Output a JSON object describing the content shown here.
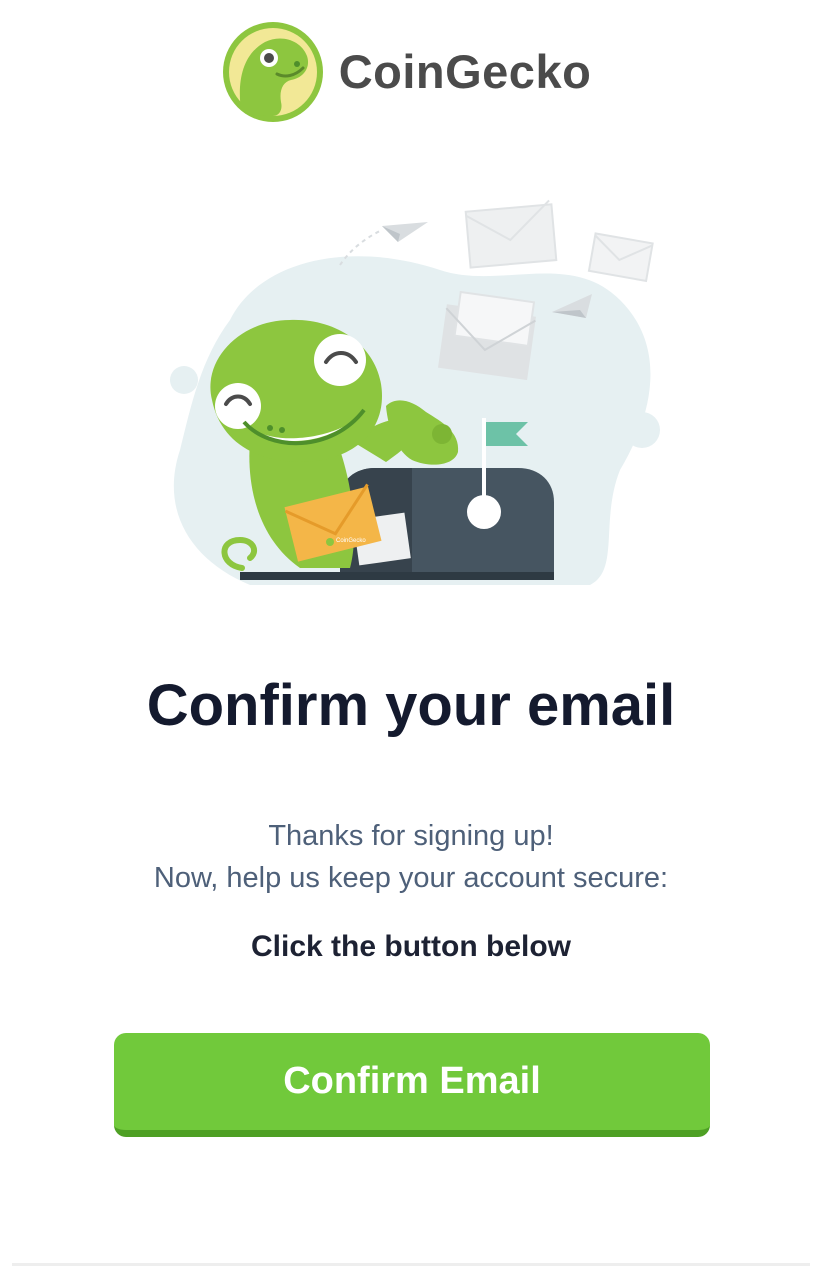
{
  "brand": {
    "name": "CoinGecko",
    "logo_icon": "gecko-logo-icon",
    "colors": {
      "brand_green": "#8dc63f",
      "logo_yellow": "#f2e896",
      "button_green": "#71c93b",
      "button_shadow": "#4ea024"
    }
  },
  "illustration": {
    "icon": "gecko-mailbox-illustration",
    "envelope_label": "CoinGecko"
  },
  "content": {
    "headline": "Confirm your email",
    "line1": "Thanks for signing up!",
    "line2": "Now, help us keep your account secure:",
    "cta_hint": "Click the button below"
  },
  "actions": {
    "confirm_label": "Confirm Email"
  }
}
